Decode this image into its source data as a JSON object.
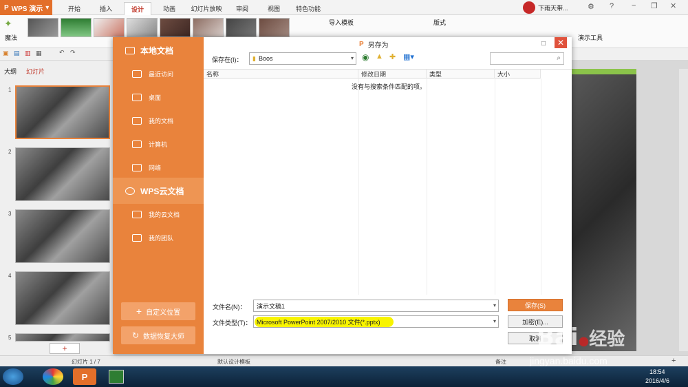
{
  "app": {
    "name": "WPS 演示"
  },
  "tabs": [
    {
      "label": "开始"
    },
    {
      "label": "插入"
    },
    {
      "label": "设计"
    },
    {
      "label": "动画"
    },
    {
      "label": "幻灯片放映"
    },
    {
      "label": "审阅"
    },
    {
      "label": "视图"
    },
    {
      "label": "特色功能"
    }
  ],
  "active_tab": "设计",
  "user": {
    "name": "下雨天带..."
  },
  "ribbon": {
    "magic_label": "魔法",
    "import_template": "导入模板",
    "format_label": "版式",
    "demo_tools": "演示工具"
  },
  "left_panel": {
    "tab_outline": "大纲",
    "tab_slides": "幻灯片",
    "slide_numbers": [
      "1",
      "2",
      "3",
      "4",
      "5"
    ]
  },
  "status": {
    "slide_info": "幻灯片 1 / 7",
    "template": "默认设计模板",
    "notes": "备注",
    "zoom_plus": "+"
  },
  "taskbar": {
    "time": "18:54",
    "date": "2016/4/6"
  },
  "dialog": {
    "title": "另存为",
    "sidebar": {
      "local_docs": "本地文档",
      "recent": "最近访问",
      "desktop": "桌面",
      "my_docs": "我的文档",
      "computer": "计算机",
      "network": "网络",
      "cloud_docs": "WPS云文档",
      "my_cloud": "我的云文档",
      "my_team": "我的团队",
      "custom_location": "自定义位置",
      "data_recovery": "数据恢复大师"
    },
    "save_in_label": "保存在(I)：",
    "save_in_value": "Boos",
    "columns": {
      "name": "名称",
      "modified": "修改日期",
      "type": "类型",
      "size": "大小"
    },
    "empty_message": "没有与搜索条件匹配的项。",
    "filename_label": "文件名(N)：",
    "filename_value": "演示文稿1",
    "filetype_label": "文件类型(T)：",
    "filetype_value": "Microsoft PowerPoint 2007/2010 文件(*.pptx)",
    "save_button": "保存(S)",
    "encrypt_button": "加密(E)...",
    "cancel_button": "取消"
  },
  "watermark": {
    "brand": "Bai",
    "brand2": "经验",
    "url": "jingyan.baidu.com"
  },
  "colors": {
    "accent": "#e9833c",
    "highlight": "#f8f400",
    "close": "#e0523c"
  }
}
